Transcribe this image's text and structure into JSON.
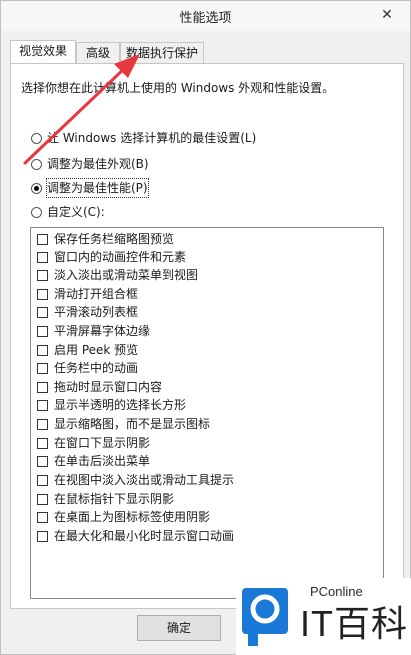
{
  "window": {
    "title": "性能选项",
    "close_glyph": "✕"
  },
  "tabs": [
    {
      "label": "视觉效果",
      "active": true
    },
    {
      "label": "高级",
      "active": false
    },
    {
      "label": "数据执行保护",
      "active": false
    }
  ],
  "description": "选择你想在此计算机上使用的 Windows 外观和性能设置。",
  "radios": [
    {
      "label": "让 Windows 选择计算机的最佳设置(L)",
      "checked": false
    },
    {
      "label": "调整为最佳外观(B)",
      "checked": false
    },
    {
      "label": "调整为最佳性能(P)",
      "checked": true
    },
    {
      "label": "自定义(C):",
      "checked": false
    }
  ],
  "effects": [
    "保存任务栏缩略图预览",
    "窗口内的动画控件和元素",
    "淡入淡出或滑动菜单到视图",
    "滑动打开组合框",
    "平滑滚动列表框",
    "平滑屏幕字体边缘",
    "启用 Peek 预览",
    "任务栏中的动画",
    "拖动时显示窗口内容",
    "显示半透明的选择长方形",
    "显示缩略图，而不是显示图标",
    "在窗口下显示阴影",
    "在单击后淡出菜单",
    "在视图中淡入淡出或滑动工具提示",
    "在鼠标指针下显示阴影",
    "在桌面上为图标标签使用阴影",
    "在最大化和最小化时显示窗口动画"
  ],
  "buttons": {
    "ok": "确定"
  },
  "watermark": {
    "small": "PConline",
    "big": "IT百科"
  },
  "colors": {
    "arrow": "#e8383d",
    "logo_blue": "#1a78d6"
  }
}
